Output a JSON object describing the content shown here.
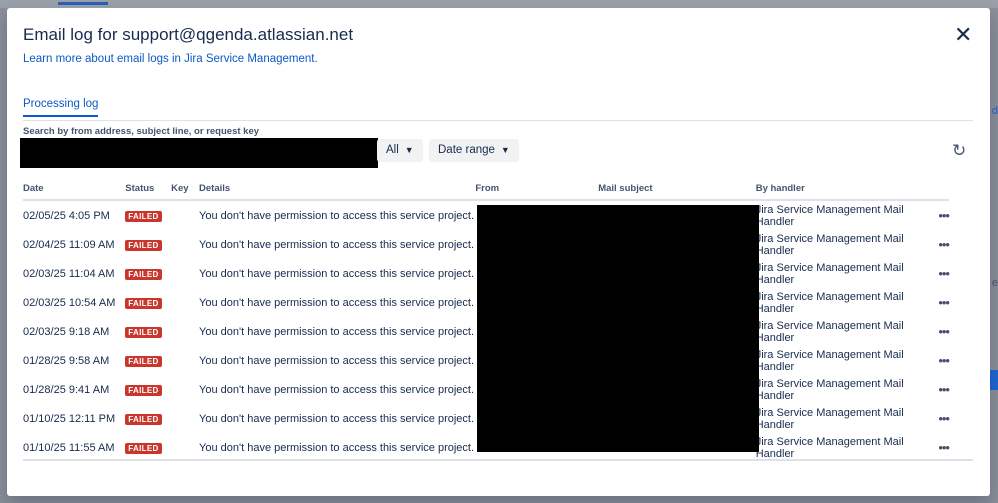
{
  "modal": {
    "title": "Email log for support@qgenda.atlassian.net",
    "learn_link": "Learn more about email logs in Jira Service Management.",
    "tab": "Processing log",
    "search_label": "Search by from address, subject line, or request key",
    "filters": {
      "status": "All",
      "date_range": "Date range"
    }
  },
  "table": {
    "headers": {
      "date": "Date",
      "status": "Status",
      "key": "Key",
      "details": "Details",
      "from": "From",
      "subject": "Mail subject",
      "handler": "By handler"
    },
    "rows": [
      {
        "date": "02/05/25 4:05 PM",
        "status": "FAILED",
        "details": "You don't have permission to access this service project.",
        "handler": "Jira Service Management Mail Handler"
      },
      {
        "date": "02/04/25 11:09 AM",
        "status": "FAILED",
        "details": "You don't have permission to access this service project.",
        "handler": "Jira Service Management Mail Handler"
      },
      {
        "date": "02/03/25 11:04 AM",
        "status": "FAILED",
        "details": "You don't have permission to access this service project.",
        "handler": "Jira Service Management Mail Handler"
      },
      {
        "date": "02/03/25 10:54 AM",
        "status": "FAILED",
        "details": "You don't have permission to access this service project.",
        "handler": "Jira Service Management Mail Handler"
      },
      {
        "date": "02/03/25 9:18 AM",
        "status": "FAILED",
        "details": "You don't have permission to access this service project.",
        "handler": "Jira Service Management Mail Handler"
      },
      {
        "date": "01/28/25 9:58 AM",
        "status": "FAILED",
        "details": "You don't have permission to access this service project.",
        "handler": "Jira Service Management Mail Handler"
      },
      {
        "date": "01/28/25 9:41 AM",
        "status": "FAILED",
        "details": "You don't have permission to access this service project.",
        "handler": "Jira Service Management Mail Handler"
      },
      {
        "date": "01/10/25 12:11 PM",
        "status": "FAILED",
        "details": "You don't have permission to access this service project.",
        "handler": "Jira Service Management Mail Handler"
      },
      {
        "date": "01/10/25 11:55 AM",
        "status": "FAILED",
        "details": "You don't have permission to access this service project.",
        "handler": "Jira Service Management Mail Handler"
      }
    ]
  },
  "icons": {
    "close": "close-icon",
    "chevron": "chevron-down-icon",
    "refresh": "refresh-icon",
    "more": "more-icon"
  },
  "colors": {
    "failed": "#c9372c",
    "link": "#0c5ac6"
  }
}
